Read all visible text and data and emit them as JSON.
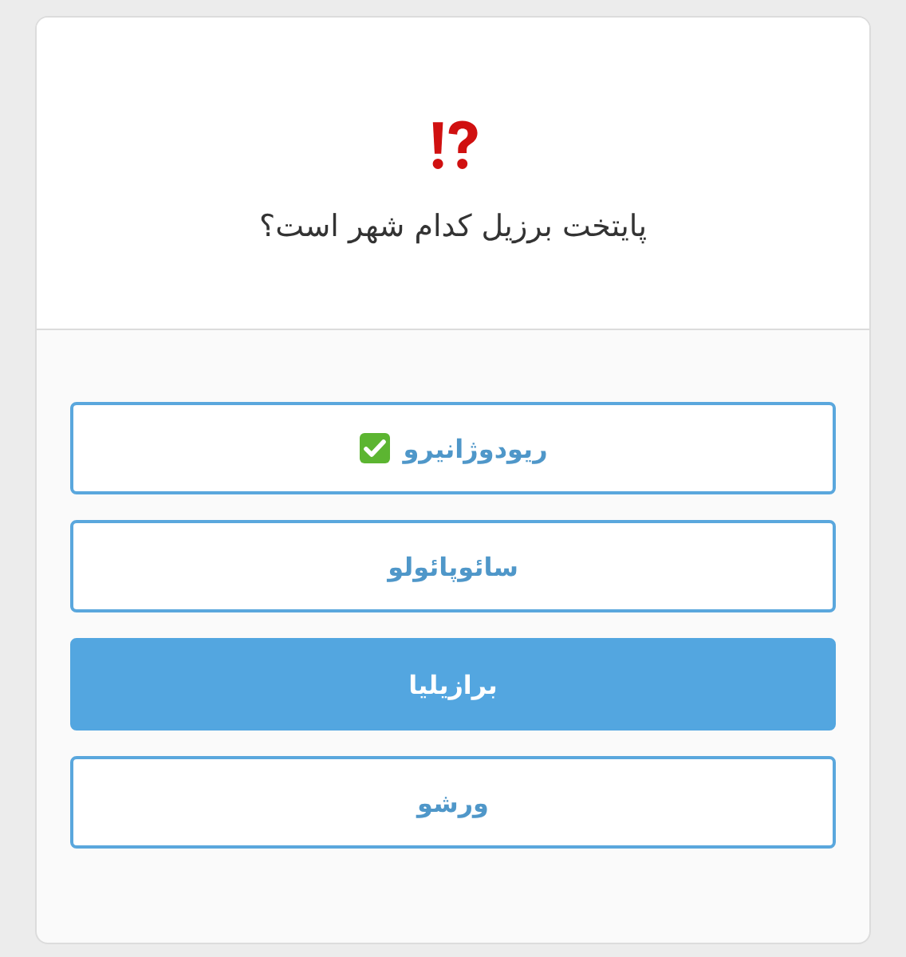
{
  "question": "پایتخت برزیل کدام شهر است؟",
  "options": [
    {
      "label": "ریودوژانیرو",
      "correct": true,
      "selected": false
    },
    {
      "label": "سائوپائولو",
      "correct": false,
      "selected": false
    },
    {
      "label": "برازیلیا",
      "correct": false,
      "selected": true
    },
    {
      "label": "ورشو",
      "correct": false,
      "selected": false
    }
  ]
}
